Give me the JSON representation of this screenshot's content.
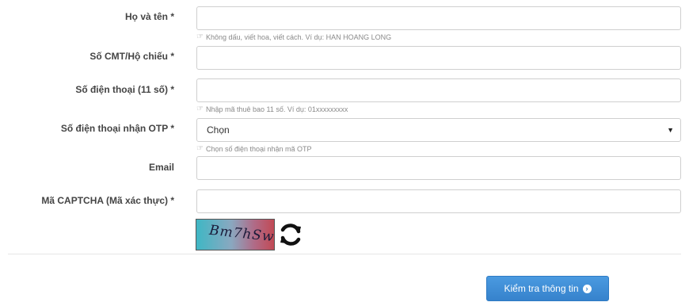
{
  "form": {
    "full_name_label": "Họ và tên *",
    "full_name_hint": "Không dấu, viết hoa, viết cách. Ví dụ: HAN HOANG LONG",
    "id_label": "Số CMT/Hộ chiếu *",
    "phone_label": "Số điện thoại (11 số) *",
    "phone_hint": "Nhập mã thuê bao 11 số. Ví dụ: 01xxxxxxxxx",
    "otp_label": "Số điện thoại nhận OTP *",
    "otp_select_value": "Chọn",
    "otp_hint": "Chọn số điện thoại nhận mã OTP",
    "email_label": "Email",
    "captcha_label": "Mã CAPTCHA (Mã xác thực) *",
    "captcha_text": "Bm7hSw",
    "submit_label": "Kiểm tra thông tin"
  },
  "icons": {
    "hint": "hand-pointing-icon",
    "refresh": "refresh-icon",
    "select_caret": "caret-down-icon",
    "submit": "arrow-circle-right-icon"
  },
  "colors": {
    "button": "#3682cc",
    "label": "#444444",
    "hint": "#8a8a8a"
  }
}
